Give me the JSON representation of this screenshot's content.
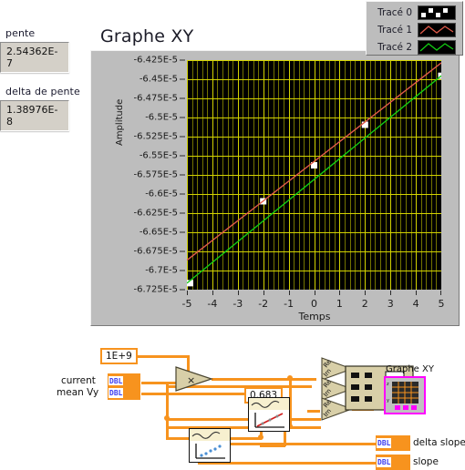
{
  "front_panel": {
    "indicators": [
      {
        "label": "pente",
        "value": "2.54362E-7",
        "name": "pente"
      },
      {
        "label": "delta de pente",
        "value": "1.38976E-8",
        "name": "delta-de-pente"
      }
    ]
  },
  "graph": {
    "title": "Graphe XY",
    "legend": {
      "rows": [
        {
          "label": "Tracé 0",
          "style": "markers",
          "color": "#ffffff"
        },
        {
          "label": "Tracé 1",
          "style": "line",
          "color": "#e05a4a"
        },
        {
          "label": "Tracé 2",
          "style": "line",
          "color": "#13cc13"
        }
      ]
    },
    "colors": {
      "plot_background": "#000000",
      "grid": "#d4d400",
      "panel": "#bdbdbd",
      "trace0": "#ffffff",
      "trace1": "#e05a4a",
      "trace2": "#13cc13"
    }
  },
  "chart_data": {
    "type": "scatter",
    "title": "Graphe XY",
    "xlabel": "Temps",
    "ylabel": "Amplitude",
    "xlim": [
      -5,
      5
    ],
    "ylim": [
      -6.725e-05,
      -6.425e-05
    ],
    "grid": true,
    "legend_position": "top-right",
    "xticks": [
      -5,
      -4,
      -3,
      -2,
      -1,
      0,
      1,
      2,
      3,
      4,
      5
    ],
    "xtick_labels": [
      "-5",
      "-4",
      "-3",
      "-2",
      "-1",
      "0",
      "1",
      "2",
      "3",
      "4",
      "5"
    ],
    "yticks": [
      -6.425e-05,
      -6.45e-05,
      -6.475e-05,
      -6.5e-05,
      -6.525e-05,
      -6.55e-05,
      -6.575e-05,
      -6.6e-05,
      -6.625e-05,
      -6.65e-05,
      -6.675e-05,
      -6.7e-05,
      -6.725e-05
    ],
    "ytick_labels": [
      "-6.425E-5",
      "-6.45E-5",
      "-6.475E-5",
      "-6.5E-5",
      "-6.525E-5",
      "-6.55E-5",
      "-6.575E-5",
      "-6.6E-5",
      "-6.625E-5",
      "-6.65E-5",
      "-6.675E-5",
      "-6.7E-5",
      "-6.725E-5"
    ],
    "series": [
      {
        "name": "Tracé 0",
        "style": "markers",
        "color": "#ffffff",
        "x": [
          -5,
          -2,
          0,
          2,
          5
        ],
        "y": [
          -6.7165e-05,
          -6.6095e-05,
          -6.5625e-05,
          -6.5095e-05,
          -6.4455e-05
        ]
      },
      {
        "name": "Tracé 1",
        "style": "line",
        "color": "#e05a4a",
        "x": [
          -5,
          5
        ],
        "y": [
          -6.6865e-05,
          -6.4285e-05
        ]
      },
      {
        "name": "Tracé 2",
        "style": "line",
        "color": "#13cc13",
        "x": [
          -5,
          5
        ],
        "y": [
          -6.7165e-05,
          -6.4455e-05
        ]
      }
    ]
  },
  "block_diagram": {
    "constants": [
      {
        "name": "gain-constant",
        "value": "1E+9"
      },
      {
        "name": "confidence-constant",
        "value": "0.683"
      }
    ],
    "controls": [
      {
        "name": "current",
        "label": "current",
        "type": "DBL"
      },
      {
        "name": "mean-vy",
        "label": "mean Vy",
        "type": "DBL"
      }
    ],
    "indicators": [
      {
        "name": "delta-slope",
        "label": "delta slope",
        "type": "DBL"
      },
      {
        "name": "slope",
        "label": "slope",
        "type": "DBL"
      },
      {
        "name": "graphe-xy",
        "label": "Graphe XY",
        "type": "graph"
      }
    ],
    "terminal_type_label": "DBL",
    "multiply_symbol": "×",
    "colors": {
      "wire": "#f7931e",
      "graph_terminal": "#ff00ff"
    }
  }
}
